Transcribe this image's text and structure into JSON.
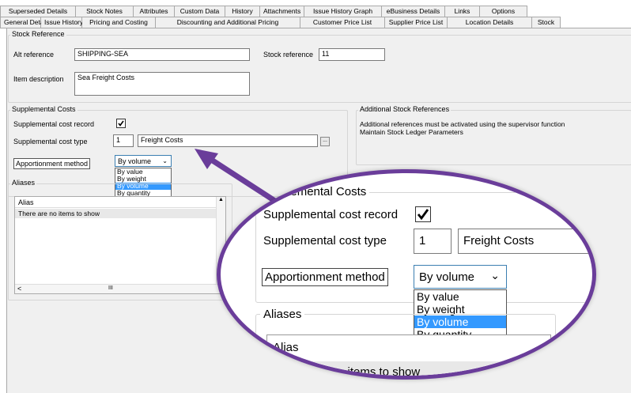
{
  "tabs_row1": [
    "Superseded Details",
    "Stock Notes",
    "Attributes",
    "Custom Data",
    "History",
    "Attachments",
    "Issue History Graph",
    "eBusiness Details",
    "Links",
    "Options"
  ],
  "tabs_row2": [
    "General Details",
    "Issue History",
    "Pricing and Costing",
    "Discounting and Additional Pricing",
    "Customer Price List",
    "Supplier Price List",
    "Location Details",
    "Stock"
  ],
  "stock_reference": {
    "group_title": "Stock Reference",
    "alt_ref_label": "Alt reference",
    "alt_ref_value": "SHIPPING-SEA",
    "stock_ref_label": "Stock reference",
    "stock_ref_value": "11",
    "item_desc_label": "Item description",
    "item_desc_value": "Sea Freight Costs"
  },
  "supplemental_costs": {
    "group_title": "Supplemental Costs",
    "record_label": "Supplemental cost record",
    "record_checked": true,
    "type_label": "Supplemental cost type",
    "type_code": "1",
    "type_name": "Freight Costs",
    "lookup_button": "...",
    "apportionment_label": "Apportionment method",
    "apportionment_value": "By volume",
    "apportionment_options": [
      "By value",
      "By weight",
      "By volume",
      "By quantity"
    ]
  },
  "additional_refs": {
    "group_title": "Additional Stock References",
    "note": "Additional references must be activated using the supervisor function Maintain Stock Ledger Parameters"
  },
  "aliases": {
    "group_title": "Aliases",
    "column_header": "Alias",
    "empty_text": "There are no items to show",
    "scroll_marker": "III"
  },
  "zoom": {
    "group_title": "Supplemental Costs",
    "aliases_title": "Aliases",
    "alias_header": "Alias",
    "empty_text_partial": "e items to show"
  },
  "colors": {
    "callout": "#6a3d9a",
    "selection": "#3399ff"
  }
}
